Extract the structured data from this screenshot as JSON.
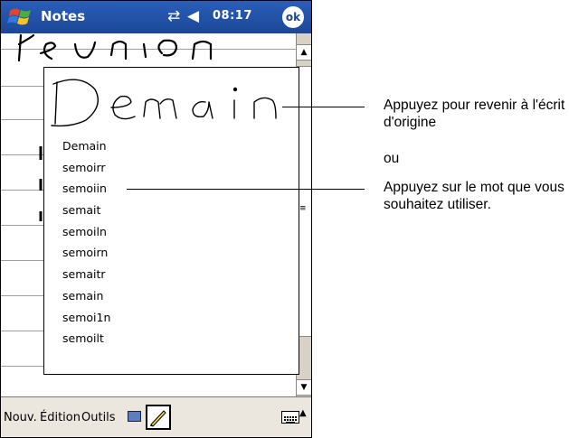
{
  "titlebar": {
    "title": "Notes",
    "time": "08:17",
    "ok_label": "ok"
  },
  "popup": {
    "handwritten_word": "Demain",
    "alternates": [
      "Demain",
      "semoirr",
      "semoiin",
      "semait",
      "semoiln",
      "semoirn",
      "semaitr",
      "semain",
      "semoi1n",
      "semoilt"
    ]
  },
  "menubar": {
    "new": "Nouv.",
    "edit": "Édition",
    "tools": "Outils"
  },
  "callouts": {
    "top": "Appuyez pour revenir à l'écrit d'origine",
    "or": "ou",
    "bottom": "Appuyez sur le mot que vous souhaitez utiliser."
  },
  "colors": {
    "titlebar": "#1c4797",
    "menubar": "#ebe7df",
    "scrollbar": "#d7d2c4"
  }
}
